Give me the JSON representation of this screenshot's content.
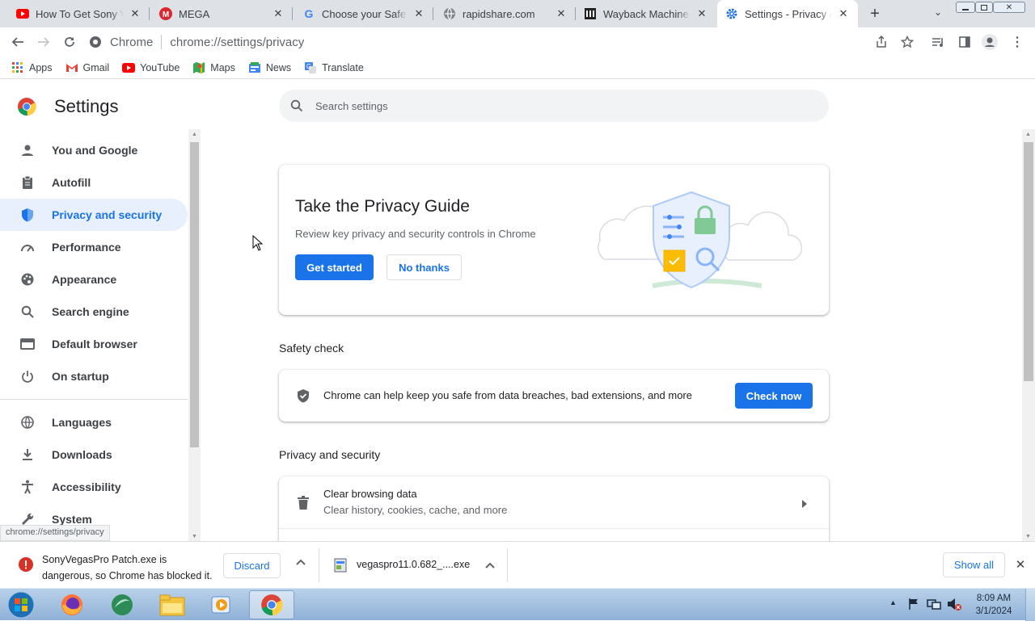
{
  "tabs": [
    {
      "title": "How To Get Sony Vegas Pro",
      "icon": "youtube-icon"
    },
    {
      "title": "MEGA",
      "icon": "mega-icon"
    },
    {
      "title": "Choose your Safe Browsing",
      "icon": "google-icon"
    },
    {
      "title": "rapidshare.com",
      "icon": "globe-icon"
    },
    {
      "title": "Wayback Machine",
      "icon": "archive-icon"
    },
    {
      "title": "Settings - Privacy and security",
      "icon": "gear-icon",
      "active": true
    }
  ],
  "omnibox": {
    "site_label": "Chrome",
    "url": "chrome://settings/privacy"
  },
  "bookmarks": [
    {
      "label": "Apps",
      "icon": "apps-grid-icon"
    },
    {
      "label": "Gmail",
      "icon": "gmail-icon"
    },
    {
      "label": "YouTube",
      "icon": "youtube-icon"
    },
    {
      "label": "Maps",
      "icon": "maps-icon"
    },
    {
      "label": "News",
      "icon": "news-icon"
    },
    {
      "label": "Translate",
      "icon": "translate-icon"
    }
  ],
  "settings": {
    "title": "Settings",
    "search_placeholder": "Search settings",
    "nav": [
      {
        "label": "You and Google",
        "icon": "person-icon"
      },
      {
        "label": "Autofill",
        "icon": "clipboard-icon"
      },
      {
        "label": "Privacy and security",
        "icon": "shield-icon",
        "selected": true
      },
      {
        "label": "Performance",
        "icon": "speedometer-icon"
      },
      {
        "label": "Appearance",
        "icon": "palette-icon"
      },
      {
        "label": "Search engine",
        "icon": "search-icon"
      },
      {
        "label": "Default browser",
        "icon": "browser-icon"
      },
      {
        "label": "On startup",
        "icon": "power-icon"
      },
      {
        "label": "Languages",
        "icon": "globe-icon"
      },
      {
        "label": "Downloads",
        "icon": "download-icon"
      },
      {
        "label": "Accessibility",
        "icon": "accessibility-icon"
      },
      {
        "label": "System",
        "icon": "wrench-icon"
      }
    ],
    "privacy_guide": {
      "title": "Take the Privacy Guide",
      "subtitle": "Review key privacy and security controls in Chrome",
      "primary_button": "Get started",
      "secondary_button": "No thanks"
    },
    "safety_check": {
      "heading": "Safety check",
      "text": "Chrome can help keep you safe from data breaches, bad extensions, and more",
      "button": "Check now"
    },
    "privacy_section": {
      "heading": "Privacy and security",
      "items": [
        {
          "title": "Clear browsing data",
          "subtitle": "Clear history, cookies, cache, and more"
        }
      ]
    },
    "status_url": "chrome://settings/privacy"
  },
  "download_bar": {
    "blocked": {
      "line1": "SonyVegasPro Patch.exe is",
      "line2": "dangerous, so Chrome has blocked it.",
      "discard": "Discard"
    },
    "file": {
      "name": "vegaspro11.0.682_....exe"
    },
    "show_all": "Show all"
  },
  "taskbar": {
    "time": "8:09 AM",
    "date": "3/1/2024",
    "apps": [
      "windows-start-icon",
      "firefox-icon",
      "app-icon",
      "file-explorer-icon",
      "media-player-icon",
      "chrome-icon"
    ]
  },
  "colors": {
    "accent": "#1a73e8",
    "selected_bg": "#e8f0fe",
    "danger": "#d93025"
  }
}
